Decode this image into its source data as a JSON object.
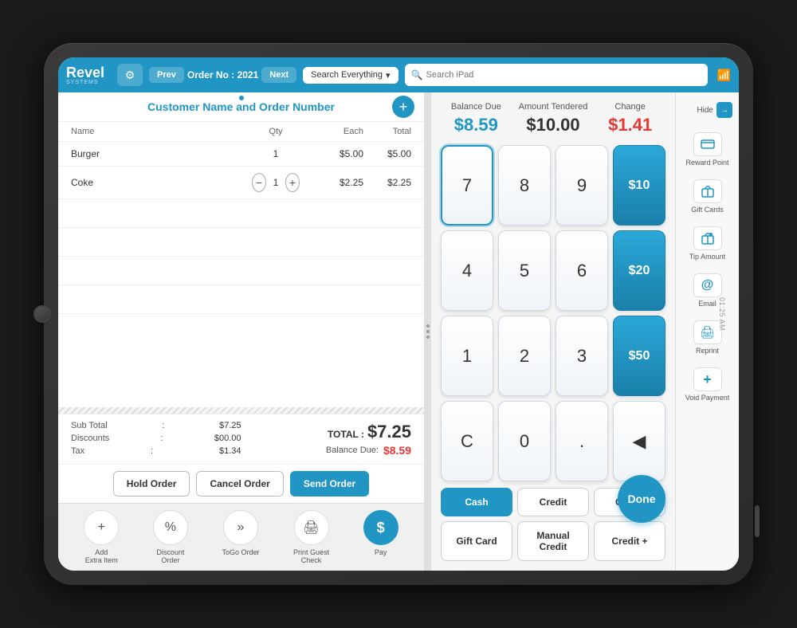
{
  "tablet": {
    "screen": "POS System"
  },
  "nav": {
    "logo": "Revel",
    "logo_sub": "SYSTEMS",
    "prev_label": "Prev",
    "next_label": "Next",
    "order_label": "Order No : 2021",
    "search_everything_label": "Search Everything",
    "search_ipad_placeholder": "Search iPad"
  },
  "order": {
    "header_title": "Customer Name and Order Number",
    "add_btn_label": "+",
    "table_headers": {
      "name": "Name",
      "qty": "Qty",
      "each": "Each",
      "total": "Total"
    },
    "items": [
      {
        "name": "Burger",
        "qty": "1",
        "each": "$5.00",
        "total": "$5.00"
      },
      {
        "name": "Coke",
        "qty": "1",
        "each": "$2.25",
        "total": "$2.25"
      }
    ],
    "sub_total_label": "Sub Total",
    "sub_total_value": "$7.25",
    "discounts_label": "Discounts",
    "discounts_value": "$00.00",
    "tax_label": "Tax",
    "tax_value": "$1.34",
    "total_label": "TOTAL :",
    "total_value": "$7.25",
    "balance_due_label": "Balance Due:",
    "balance_due_value": "$8.59",
    "hold_order_label": "Hold Order",
    "cancel_order_label": "Cancel Order",
    "send_order_label": "Send Order"
  },
  "toolbar": {
    "items": [
      {
        "icon": "+",
        "label": "Add\nExtra Item"
      },
      {
        "icon": "%",
        "label": "Discount\nOrder"
      },
      {
        "icon": "»",
        "label": "ToGo Order"
      },
      {
        "icon": "🖨",
        "label": "Print Guest\nCheck"
      }
    ],
    "pay_label": "$",
    "pay_text": "Pay"
  },
  "payment": {
    "balance_due_label": "Balance Due",
    "balance_due_value": "$8.59",
    "amount_tendered_label": "Amount Tendered",
    "amount_tendered_value": "$10.00",
    "change_label": "Change",
    "change_value": "$1.41",
    "numpad": {
      "buttons": [
        "7",
        "8",
        "9",
        "4",
        "5",
        "6",
        "1",
        "2",
        "3",
        "C",
        "0",
        ".",
        "⌫"
      ],
      "presets": [
        "$10",
        "$20",
        "$50"
      ]
    },
    "methods": [
      {
        "label": "Cash",
        "active": true
      },
      {
        "label": "Credit",
        "active": false
      },
      {
        "label": "Check",
        "active": false
      },
      {
        "label": "Gift Card",
        "active": false
      },
      {
        "label": "Manual Credit",
        "active": false
      },
      {
        "label": "Credit +",
        "active": false
      }
    ],
    "done_label": "Done"
  },
  "sidebar": {
    "hide_label": "Hide",
    "items": [
      {
        "icon": "💳",
        "label": "Reward Point"
      },
      {
        "icon": "🎁",
        "label": "Gift Cards"
      },
      {
        "icon": "💡",
        "label": "Tip Amount"
      },
      {
        "icon": "@",
        "label": "Email"
      },
      {
        "icon": "🖨",
        "label": "Reprint"
      },
      {
        "icon": "+",
        "label": "Void Payment"
      }
    ]
  },
  "time": "01:25 AM"
}
